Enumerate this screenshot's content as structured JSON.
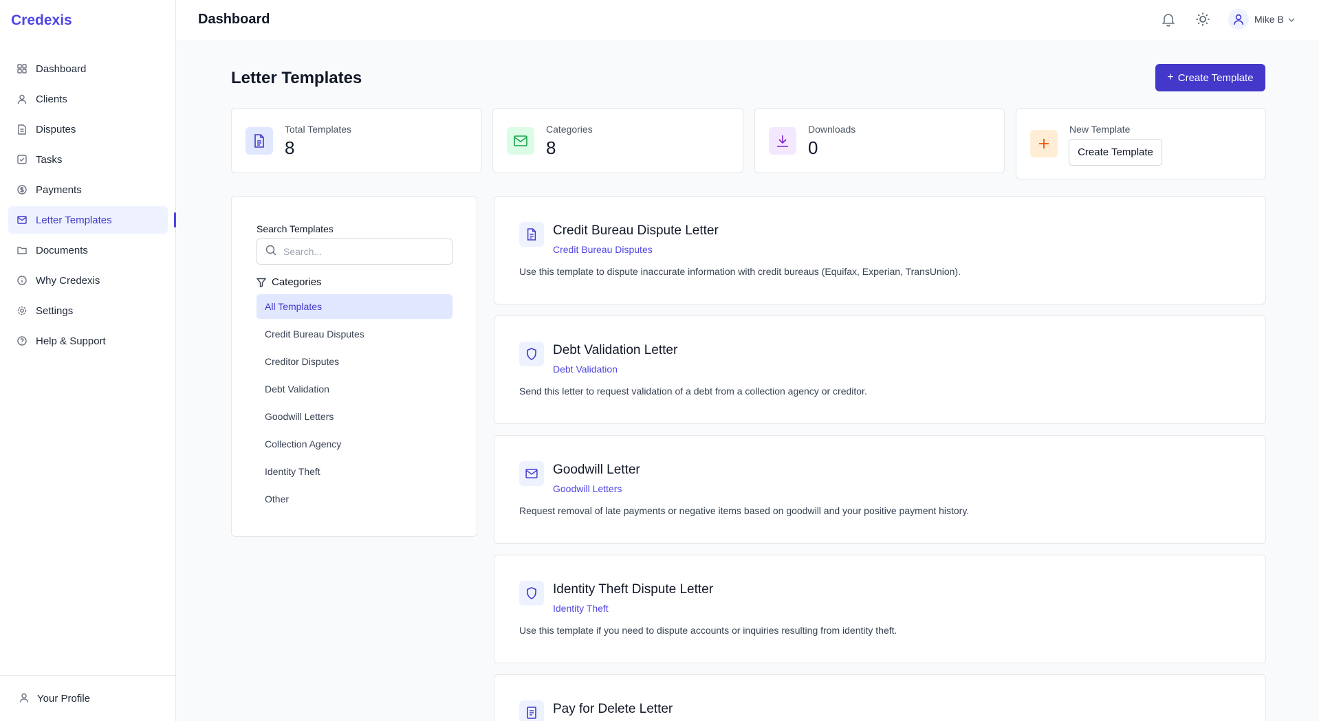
{
  "brand": "Credexis",
  "nav": [
    {
      "label": "Dashboard",
      "icon": "grid-icon"
    },
    {
      "label": "Clients",
      "icon": "user-icon"
    },
    {
      "label": "Disputes",
      "icon": "file-icon"
    },
    {
      "label": "Tasks",
      "icon": "check-square-icon"
    },
    {
      "label": "Payments",
      "icon": "dollar-circle-icon"
    },
    {
      "label": "Letter Templates",
      "icon": "mail-icon",
      "active": true
    },
    {
      "label": "Documents",
      "icon": "folder-icon"
    },
    {
      "label": "Why Credexis",
      "icon": "info-icon"
    },
    {
      "label": "Settings",
      "icon": "gear-icon"
    },
    {
      "label": "Help & Support",
      "icon": "help-circle-icon"
    }
  ],
  "profile_link": "Your Profile",
  "header": {
    "title": "Dashboard",
    "user_name": "Mike B"
  },
  "page": {
    "title": "Letter Templates",
    "create_button": "Create Template"
  },
  "stats": {
    "total_label": "Total Templates",
    "total_value": "8",
    "categories_label": "Categories",
    "categories_value": "8",
    "downloads_label": "Downloads",
    "downloads_value": "0",
    "new_label": "New Template",
    "new_button": "Create Template"
  },
  "filters": {
    "search_label": "Search Templates",
    "search_placeholder": "Search...",
    "categories_label": "Categories",
    "categories": [
      "All Templates",
      "Credit Bureau Disputes",
      "Creditor Disputes",
      "Debt Validation",
      "Goodwill Letters",
      "Collection Agency",
      "Identity Theft",
      "Other"
    ]
  },
  "templates": [
    {
      "title": "Credit Bureau Dispute Letter",
      "category": "Credit Bureau Disputes",
      "description": "Use this template to dispute inaccurate information with credit bureaus (Equifax, Experian, TransUnion).",
      "icon": "document-icon"
    },
    {
      "title": "Debt Validation Letter",
      "category": "Debt Validation",
      "description": "Send this letter to request validation of a debt from a collection agency or creditor.",
      "icon": "shield-icon"
    },
    {
      "title": "Goodwill Letter",
      "category": "Goodwill Letters",
      "description": "Request removal of late payments or negative items based on goodwill and your positive payment history.",
      "icon": "mail-icon"
    },
    {
      "title": "Identity Theft Dispute Letter",
      "category": "Identity Theft",
      "description": "Use this template if you need to dispute accounts or inquiries resulting from identity theft.",
      "icon": "shield-icon"
    },
    {
      "title": "Pay for Delete Letter",
      "category": "",
      "description": "",
      "icon": "list-document-icon"
    }
  ],
  "colors": {
    "accent": "#4338ca",
    "accent_light": "#eef2ff"
  }
}
